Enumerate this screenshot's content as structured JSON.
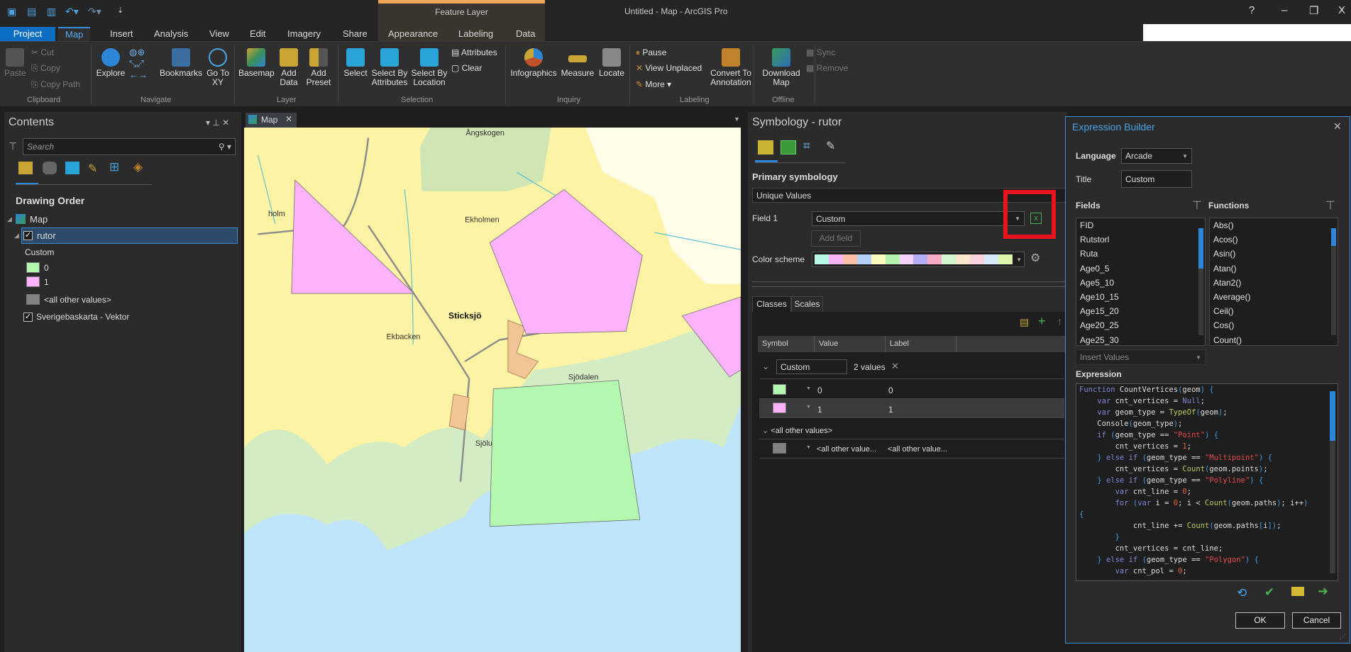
{
  "app": {
    "title": "Untitled - Map - ArcGIS Pro",
    "context_tab_group": "Feature Layer",
    "window_controls": {
      "help": "?",
      "minimize": "–",
      "restore": "❐",
      "close": "X"
    }
  },
  "tabs": [
    "Project",
    "Map",
    "Insert",
    "Analysis",
    "View",
    "Edit",
    "Imagery",
    "Share",
    "Appearance",
    "Labeling",
    "Data"
  ],
  "active_tab": "Map",
  "ribbon": {
    "clipboard": {
      "label": "Clipboard",
      "paste": "Paste",
      "cut": "Cut",
      "copy": "Copy",
      "copy_path": "Copy Path"
    },
    "navigate": {
      "label": "Navigate",
      "explore": "Explore",
      "bookmarks": "Bookmarks",
      "go_to_xy": "Go To XY"
    },
    "layer": {
      "label": "Layer",
      "basemap": "Basemap",
      "add_data": "Add Data",
      "add_preset": "Add Preset"
    },
    "selection": {
      "label": "Selection",
      "select": "Select",
      "select_by_attributes": "Select By Attributes",
      "select_by_location": "Select By Location",
      "attributes": "Attributes",
      "clear": "Clear"
    },
    "inquiry": {
      "label": "Inquiry",
      "infographics": "Infographics",
      "measure": "Measure",
      "locate": "Locate"
    },
    "labeling": {
      "label": "Labeling",
      "pause": "Pause",
      "view_unplaced": "View Unplaced",
      "more": "More",
      "convert": "Convert To Annotation"
    },
    "offline": {
      "label": "Offline",
      "download_map": "Download Map",
      "sync": "Sync",
      "remove": "Remove"
    }
  },
  "contents": {
    "title": "Contents",
    "search_placeholder": "Search",
    "section": "Drawing Order",
    "map_name": "Map",
    "layer": {
      "name": "rutor",
      "checked": true,
      "field": "Custom",
      "classes": [
        {
          "label": "0",
          "color": "#b3f7b0"
        },
        {
          "label": "1",
          "color": "#fcb3fc"
        },
        {
          "label": "<all other values>",
          "color": "#828282"
        }
      ]
    },
    "basemap_layer": {
      "name": "Sverigebaskarta - Vektor",
      "checked": true
    }
  },
  "map_view": {
    "tab": "Map",
    "labels": [
      "Ångskogen",
      "holm",
      "Ekholmen",
      "Sticksjö",
      "Ekbacken",
      "Sjödalen",
      "Sjölu"
    ]
  },
  "symbology": {
    "title": "Symbology - rutor",
    "primary_heading": "Primary symbology",
    "method": "Unique Values",
    "field1_label": "Field 1",
    "field1_value": "Custom",
    "add_field": "Add field",
    "color_scheme_label": "Color scheme",
    "color_scheme": [
      "#b8f6e6",
      "#f7b4f5",
      "#fbbfa8",
      "#b4d0f7",
      "#fbfbc0",
      "#b4f2ad",
      "#f3d3f8",
      "#b5aef6",
      "#f7abc6",
      "#d3f6cf",
      "#fbe7cb",
      "#fad2dd",
      "#d7e9fb",
      "#dcf7ab"
    ],
    "tabs": [
      "Classes",
      "Scales"
    ],
    "columns": [
      "Symbol",
      "Value",
      "Label"
    ],
    "group": {
      "name": "Custom",
      "count": "2 values"
    },
    "rows": [
      {
        "color": "#b3f7b0",
        "value": "0",
        "label": "0"
      },
      {
        "color": "#fcb3fc",
        "value": "1",
        "label": "1"
      }
    ],
    "other_group": "<all other values>",
    "other_row": {
      "color": "#828282",
      "value": "<all other value...",
      "label": "<all other value..."
    },
    "highlight_color": "#e8141e"
  },
  "expression_builder": {
    "title": "Expression Builder",
    "language_label": "Language",
    "language": "Arcade",
    "title_label": "Title",
    "title_value": "Custom",
    "fields_label": "Fields",
    "functions_label": "Functions",
    "fields": [
      "FID",
      "Rutstorl",
      "Ruta",
      "Age0_5",
      "Age5_10",
      "Age10_15",
      "Age15_20",
      "Age20_25",
      "Age25_30"
    ],
    "functions": [
      "Abs()",
      "Acos()",
      "Asin()",
      "Atan()",
      "Atan2()",
      "Average()",
      "Ceil()",
      "Cos()",
      "Count()"
    ],
    "insert_values": "Insert Values",
    "expression_label": "Expression",
    "code": [
      "Function CountVertices(geom) {",
      "    var cnt_vertices = Null;",
      "    var geom_type = TypeOf(geom);",
      "    Console(geom_type);",
      "    if (geom_type == \"Point\") {",
      "        cnt_vertices = 1;",
      "    } else if (geom_type == \"Multipoint\") {",
      "        cnt_vertices = Count(geom.points);",
      "    } else if (geom_type == \"Polyline\") {",
      "        var cnt_line = 0;",
      "        for (var i = 0; i < Count(geom.paths); i++)",
      "{",
      "            cnt_line += Count(geom.paths[i]);",
      "        }",
      "        cnt_vertices = cnt_line;",
      "    } else if (geom_type == \"Polygon\") {",
      "        var cnt_pol = 0;"
    ],
    "ok": "OK",
    "cancel": "Cancel"
  }
}
